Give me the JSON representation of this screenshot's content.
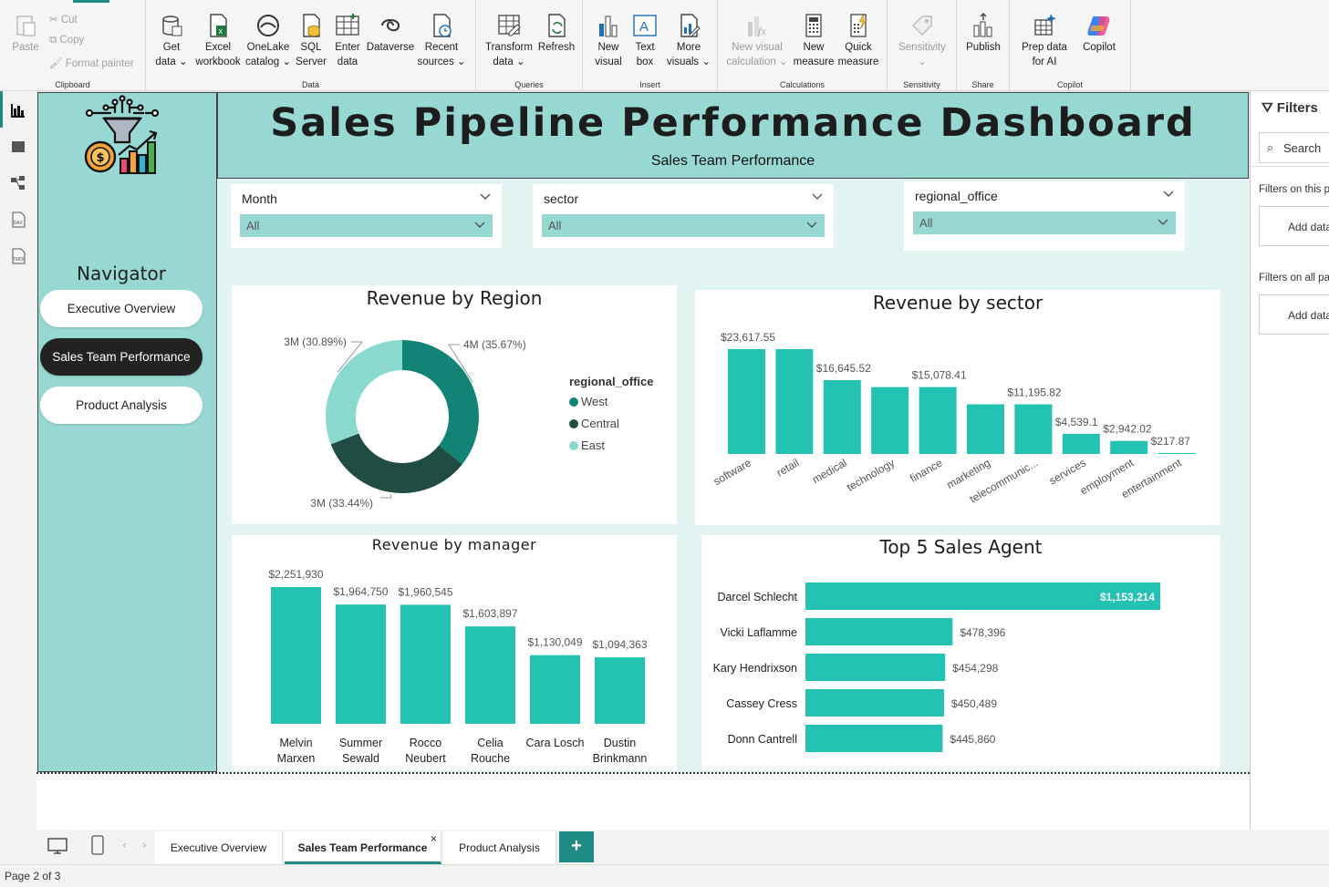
{
  "ribbon": {
    "clipboard": {
      "paste": "Paste",
      "cut": "Cut",
      "copy": "Copy",
      "format_painter": "Format painter",
      "label": "Clipboard"
    },
    "data": {
      "get_data": "Get data",
      "excel": "Excel workbook",
      "onelake": "OneLake catalog",
      "sql": "SQL Server",
      "enter": "Enter data",
      "dataverse": "Dataverse",
      "recent": "Recent sources",
      "label": "Data"
    },
    "queries": {
      "transform": "Transform data",
      "refresh": "Refresh",
      "label": "Queries"
    },
    "insert": {
      "new_visual": "New visual",
      "text_box": "Text box",
      "more_visuals": "More visuals",
      "label": "Insert"
    },
    "calculations": {
      "new_visual_calc": "New visual calculation",
      "new_measure": "New measure",
      "quick_measure": "Quick measure",
      "label": "Calculations"
    },
    "sensitivity": {
      "sensitivity": "Sensitivity",
      "label": "Sensitivity"
    },
    "share": {
      "publish": "Publish",
      "label": "Share"
    },
    "copilot": {
      "prep": "Prep data for AI",
      "copilot": "Copilot",
      "label": "Copilot"
    }
  },
  "report": {
    "title": "Sales Pipeline Performance Dashboard",
    "subtitle": "Sales Team Performance"
  },
  "navigator": {
    "label": "Navigator",
    "buttons": [
      "Executive Overview",
      "Sales Team Performance",
      "Product Analysis"
    ],
    "active_index": 1
  },
  "slicers": [
    {
      "title": "Month",
      "value": "All"
    },
    {
      "title": "sector",
      "value": "All"
    },
    {
      "title": "regional_office",
      "value": "All"
    }
  ],
  "filters_pane": {
    "title": "Filters",
    "search": "Search",
    "on_this_page": "Filters on this page",
    "on_all_pages": "Filters on all pages",
    "add_data": "Add data fields here"
  },
  "page_tabs": [
    "Executive Overview",
    "Sales Team Performance",
    "Product Analysis"
  ],
  "add_page": "+",
  "close_tab": "×",
  "status": "Page 2 of 3",
  "colors": {
    "teal": "#23c2b3",
    "dark_teal": "#128475",
    "darkest": "#1f4d44",
    "light_teal": "#8ad9cf",
    "panel": "#97d8d2"
  },
  "chart_data": [
    {
      "type": "pie",
      "title": "Revenue by Region",
      "legend_title": "regional_office",
      "legend_position": "right",
      "categories": [
        "West",
        "Central",
        "East"
      ],
      "values": [
        35.67,
        33.44,
        30.89
      ],
      "labels": [
        "4M (35.67%)",
        "3M (33.44%)",
        "3M (30.89%)"
      ],
      "colors": [
        "#128475",
        "#1f4d44",
        "#8ad9cf"
      ]
    },
    {
      "type": "bar",
      "title": "Revenue by sector",
      "categories": [
        "software",
        "retail",
        "medical",
        "technology",
        "finance",
        "marketing",
        "telecommunic...",
        "services",
        "employment",
        "entertainment"
      ],
      "values": [
        23617.55,
        23617.55,
        16645.52,
        15078.41,
        15078.41,
        11195.82,
        11195.82,
        4539.1,
        2942.02,
        217.87
      ],
      "data_labels": [
        "$23,617.55",
        "",
        "$16,645.52",
        "",
        "$15,078.41",
        "",
        "$11,195.82",
        "$4,539.1",
        "$2,942.02",
        "$217.87"
      ]
    },
    {
      "type": "bar",
      "title": "Revenue by manager",
      "categories": [
        "Melvin Marxen",
        "Summer Sewald",
        "Rocco Neubert",
        "Celia Rouche",
        "Cara Losch",
        "Dustin Brinkmann"
      ],
      "values": [
        2251930,
        1964750,
        1960545,
        1603897,
        1130049,
        1094363
      ],
      "data_labels": [
        "$2,251,930",
        "$1,964,750",
        "$1,960,545",
        "$1,603,897",
        "$1,130,049",
        "$1,094,363"
      ]
    },
    {
      "type": "bar",
      "orientation": "horizontal",
      "title": "Top 5 Sales Agent",
      "categories": [
        "Darcel Schlecht",
        "Vicki Laflamme",
        "Kary Hendrixson",
        "Cassey Cress",
        "Donn Cantrell"
      ],
      "values": [
        1153214,
        478396,
        454298,
        450489,
        445860
      ],
      "data_labels": [
        "$1,153,214",
        "$478,396",
        "$454,298",
        "$450,489",
        "$445,860"
      ]
    }
  ]
}
